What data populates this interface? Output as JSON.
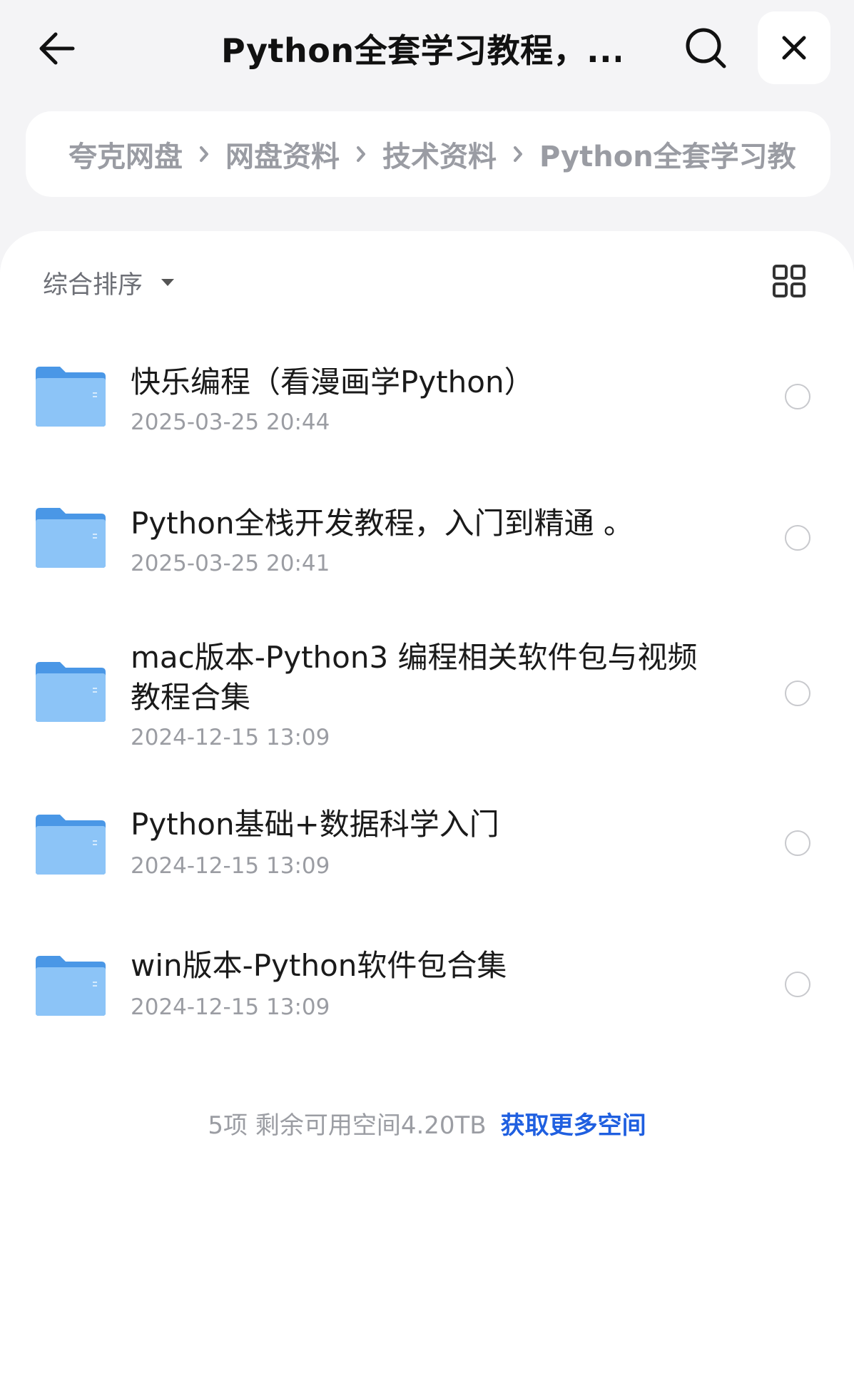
{
  "header": {
    "title": "Python全套学习教程，...",
    "back_icon": "arrow-left-icon",
    "search_icon": "search-icon",
    "close_icon": "close-icon"
  },
  "breadcrumb": {
    "items": [
      "夸克网盘",
      "网盘资料",
      "技术资料",
      "Python全套学习教"
    ],
    "separator_icon": "chevron-right-icon"
  },
  "toolbar": {
    "sort_label": "综合排序",
    "sort_caret_icon": "caret-down-icon",
    "view_toggle_icon": "grid-view-icon"
  },
  "files": [
    {
      "name": "快乐编程（看漫画学Python）",
      "date": "2025-03-25 20:44",
      "icon": "folder-icon"
    },
    {
      "name": "Python全栈开发教程，入门到精通 。",
      "date": "2025-03-25 20:41",
      "icon": "folder-icon"
    },
    {
      "name_line1": "mac版本-Python3 编程相关软件包与视频",
      "name_line2": "教程合集",
      "date": "2024-12-15 13:09",
      "icon": "folder-icon"
    },
    {
      "name": "Python基础+数据科学入门",
      "date": "2024-12-15 13:09",
      "icon": "folder-icon"
    },
    {
      "name": "win版本-Python软件包合集",
      "date": "2024-12-15 13:09",
      "icon": "folder-icon"
    }
  ],
  "footer": {
    "count_text": "5项 剩余可用空间4.20TB",
    "link_text": "获取更多空间"
  },
  "colors": {
    "background": "#f4f4f6",
    "folder_blue": "#6fb2f3",
    "link_blue": "#1f5fe0"
  }
}
